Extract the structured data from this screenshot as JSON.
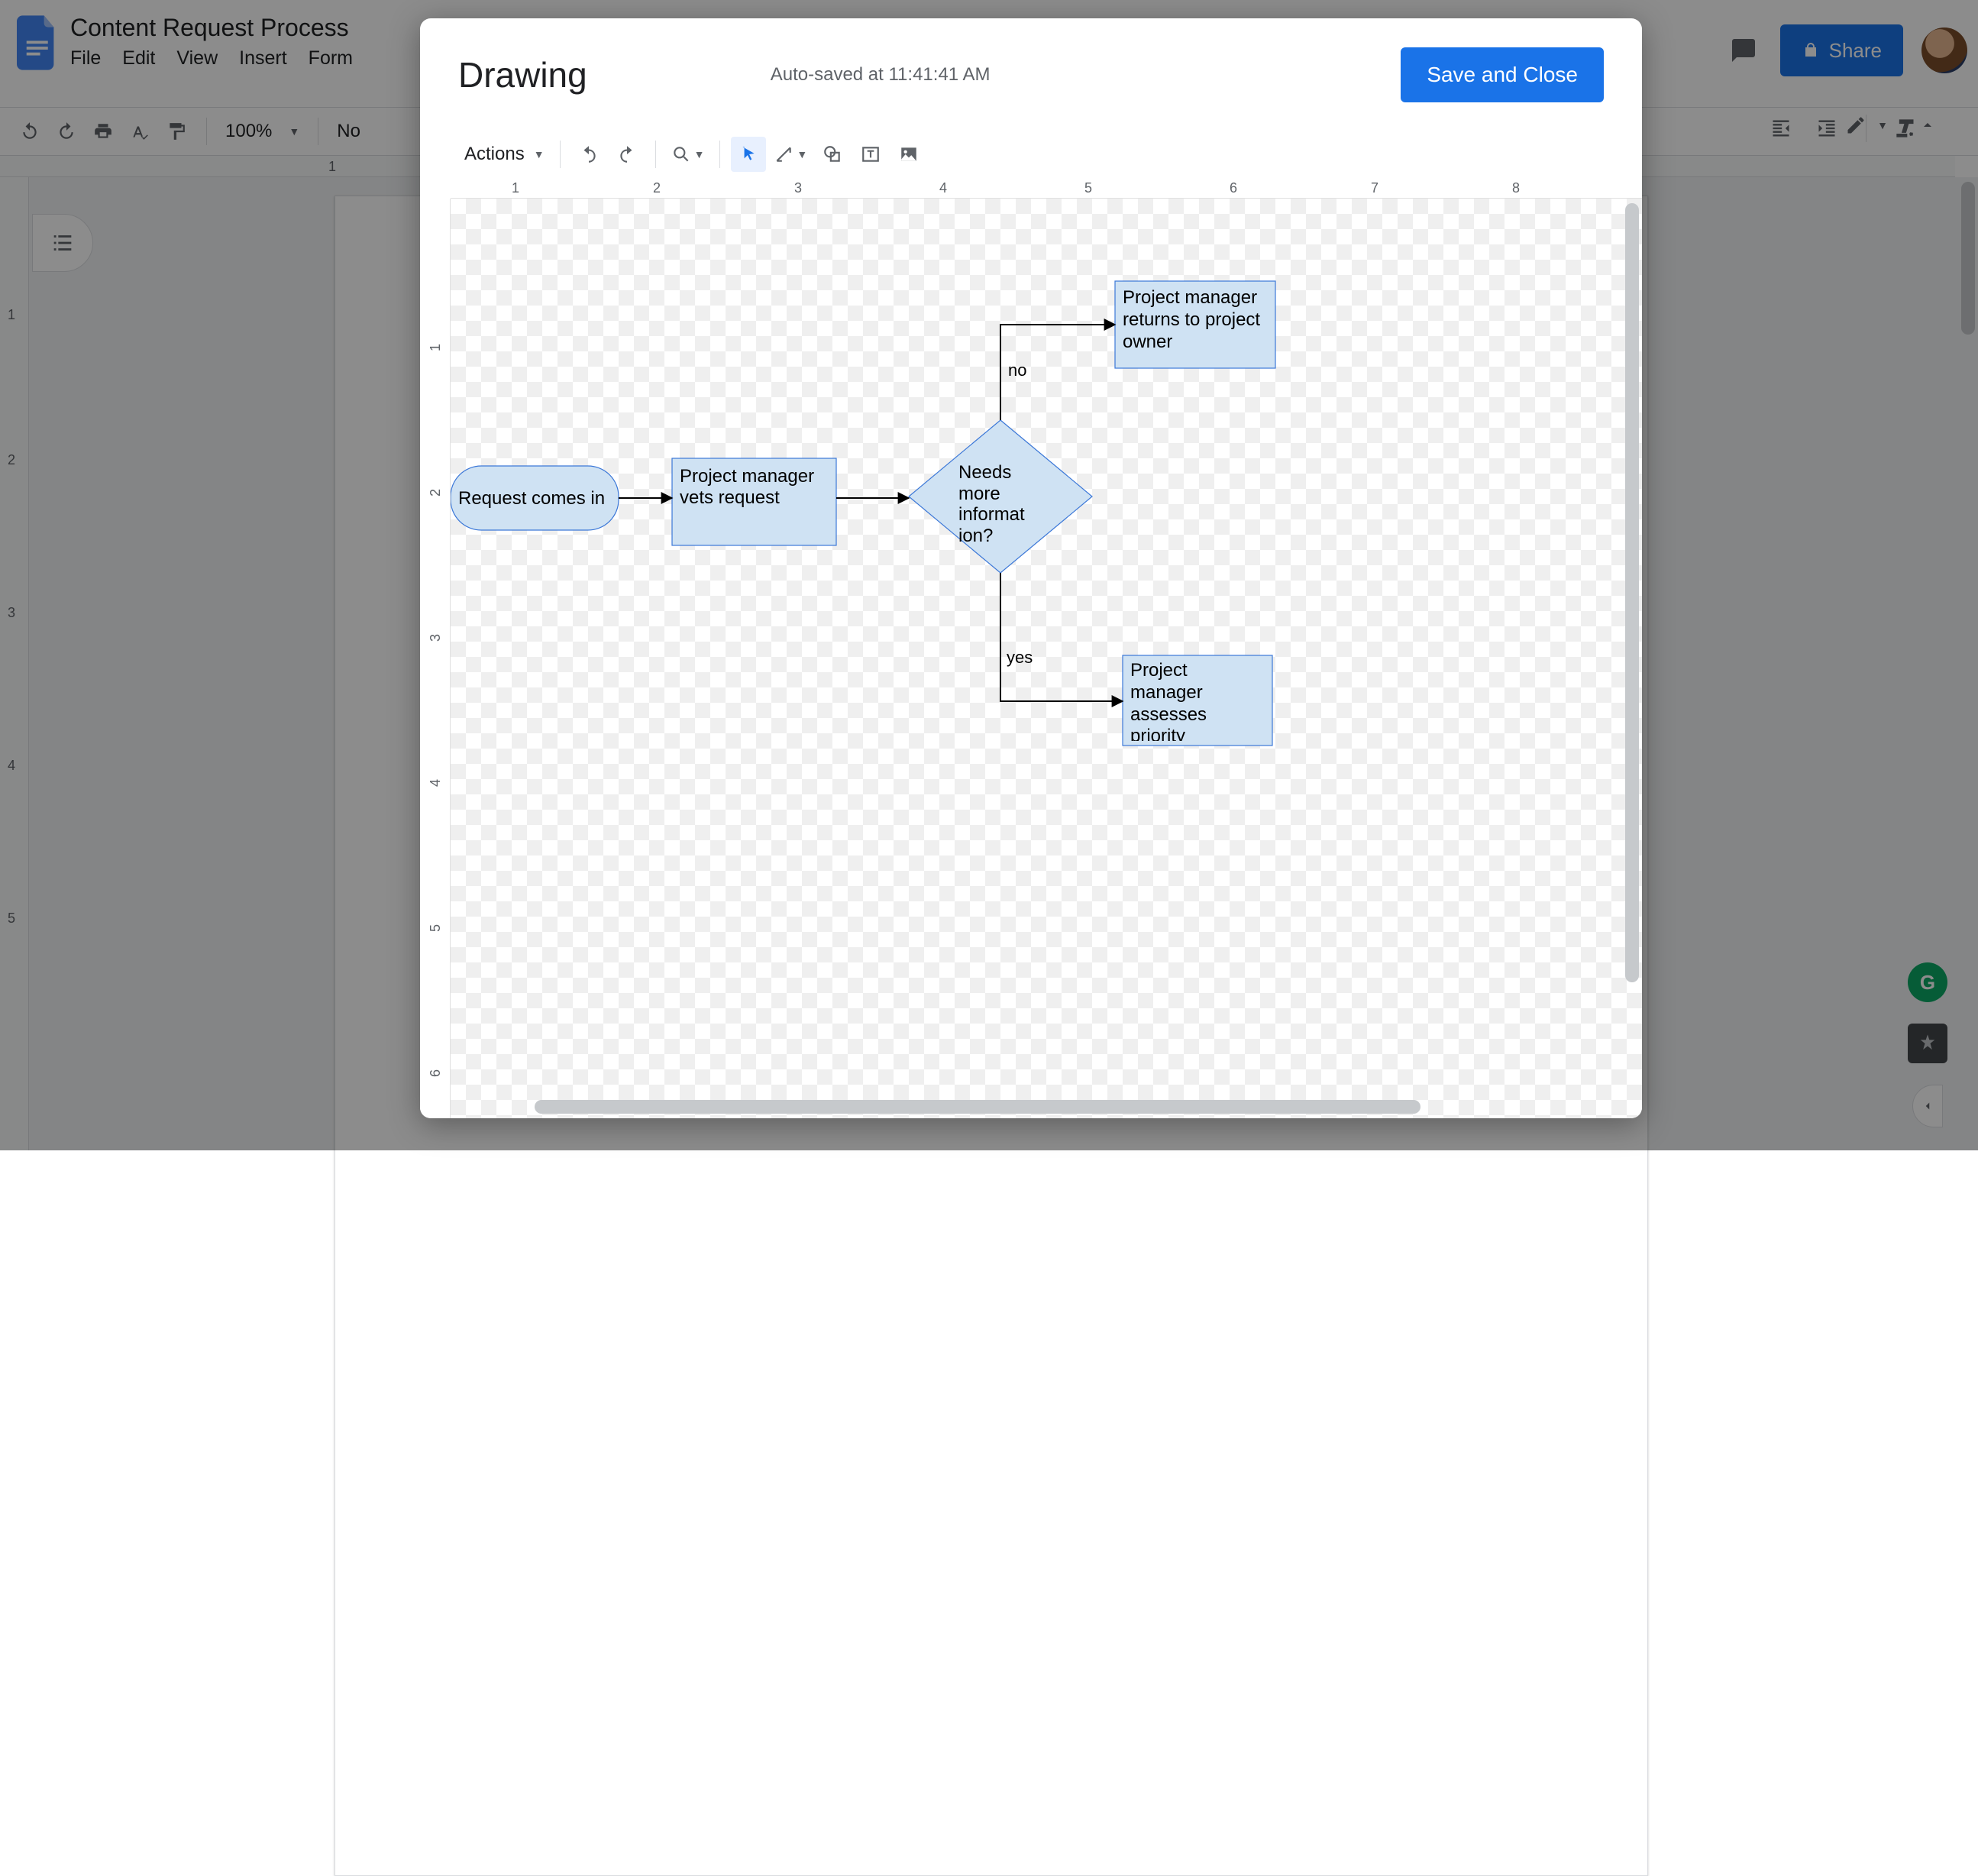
{
  "docs": {
    "title": "Content Request Process",
    "menus": [
      "File",
      "Edit",
      "View",
      "Insert",
      "Form"
    ],
    "share_label": "Share",
    "zoom": "100%",
    "style_peek": "No",
    "ruler_h": [
      "1"
    ],
    "ruler_v": [
      "1",
      "2",
      "3",
      "4",
      "5"
    ]
  },
  "modal": {
    "title": "Drawing",
    "autosave": "Auto-saved at 11:41:41 AM",
    "save_close": "Save and Close",
    "actions_label": "Actions",
    "ruler_h_nums": [
      "1",
      "2",
      "3",
      "4",
      "5",
      "6",
      "7",
      "8"
    ],
    "ruler_v_nums": [
      "1",
      "2",
      "3",
      "4",
      "5",
      "6"
    ]
  },
  "flow": {
    "start": "Request comes in",
    "vet": "Project manager vets request",
    "decision": "Needs more informat ion?",
    "no_label": "no",
    "yes_label": "yes",
    "return_owner": "Project manager returns to project owner",
    "assess": "Project manager assesses priority"
  },
  "icons": {
    "undo": "undo",
    "redo": "redo",
    "print": "print",
    "spell": "spellcheck",
    "paint": "format-paint",
    "zoom": "zoom",
    "select": "select",
    "line": "line",
    "shape": "shape",
    "textbox": "textbox",
    "image": "image"
  }
}
